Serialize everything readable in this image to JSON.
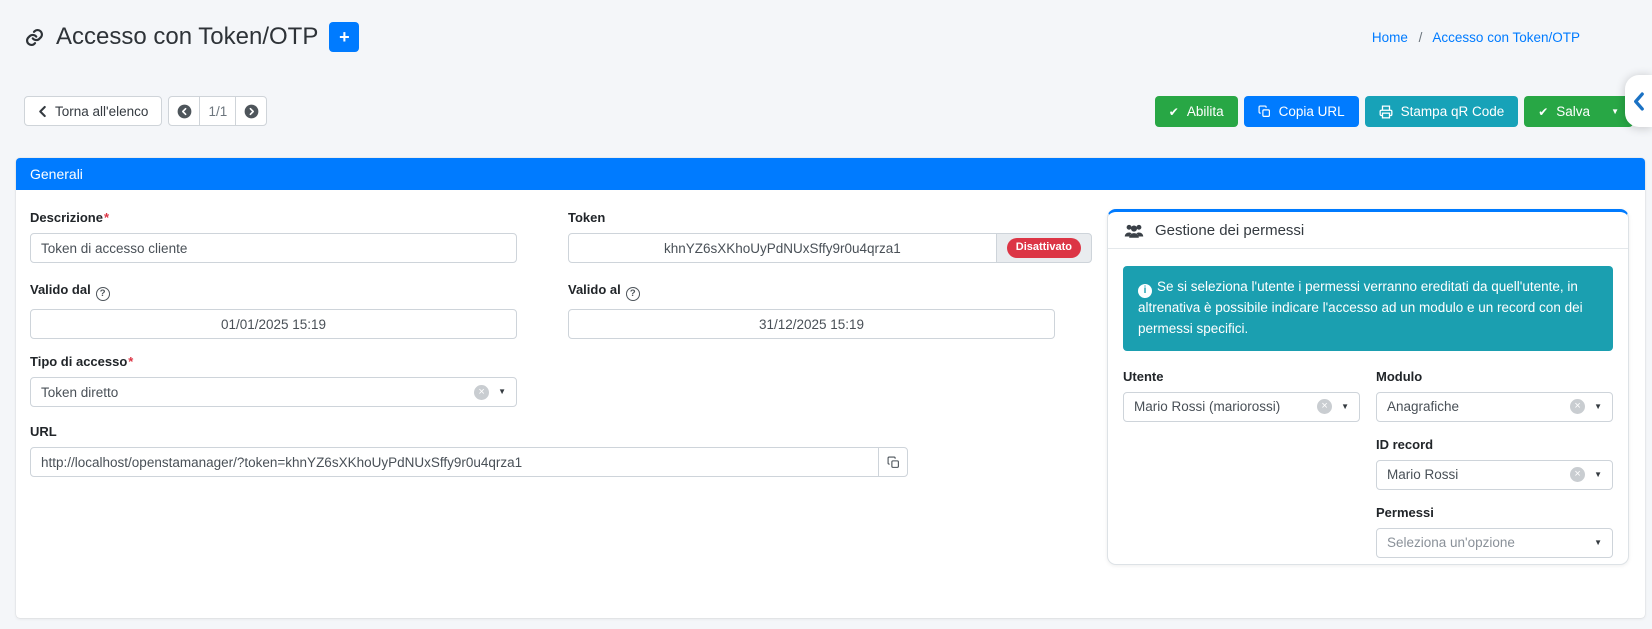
{
  "header": {
    "title": "Accesso con Token/OTP",
    "breadcrumb": {
      "home": "Home",
      "separator": "/",
      "current": "Accesso con Token/OTP"
    }
  },
  "toolbar": {
    "back_label": "Torna all'elenco",
    "pager": "1/1",
    "enable_label": "Abilita",
    "copy_url_label": "Copia URL",
    "print_qr_label": "Stampa qR Code",
    "save_label": "Salva"
  },
  "panel": {
    "title": "Generali"
  },
  "form": {
    "descrizione": {
      "label": "Descrizione",
      "required": "*",
      "value": "Token di accesso cliente"
    },
    "token": {
      "label": "Token",
      "value": "khnYZ6sXKhoUyPdNUxSffy9r0u4qrza1",
      "badge": "Disattivato"
    },
    "valido_dal": {
      "label": "Valido dal",
      "value": "01/01/2025 15:19"
    },
    "valido_al": {
      "label": "Valido al",
      "value": "31/12/2025 15:19"
    },
    "tipo_accesso": {
      "label": "Tipo di accesso",
      "required": "*",
      "value": "Token diretto"
    },
    "url": {
      "label": "URL",
      "value": "http://localhost/openstamanager/?token=khnYZ6sXKhoUyPdNUxSffy9r0u4qrza1"
    }
  },
  "permessi": {
    "title": "Gestione dei permessi",
    "info": "Se si seleziona l'utente i permessi verranno ereditati da quell'utente, in altrenativa è possibile indicare l'accesso ad un modulo e un record con dei permessi specifici.",
    "utente": {
      "label": "Utente",
      "value": "Mario Rossi (mariorossi)"
    },
    "modulo": {
      "label": "Modulo",
      "value": "Anagrafiche"
    },
    "id_record": {
      "label": "ID record",
      "value": "Mario Rossi"
    },
    "permessi": {
      "label": "Permessi",
      "placeholder": "Seleziona un'opzione"
    }
  },
  "icons": {
    "plus": "+",
    "check": "✔",
    "caret": "▼",
    "clear": "×",
    "help": "?",
    "info": "i"
  },
  "colors": {
    "primary": "#007bff",
    "success": "#28a745",
    "info_box": "#1b9fb0",
    "danger": "#dc3545",
    "page_bg": "#f4f6f9"
  }
}
